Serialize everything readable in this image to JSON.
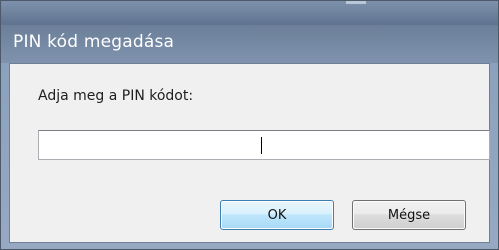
{
  "dialog": {
    "title": "PIN kód megadása",
    "prompt": "Adja meg a PIN kódot:",
    "pin_value": "",
    "ok_label": "OK",
    "cancel_label": "Mégse"
  }
}
